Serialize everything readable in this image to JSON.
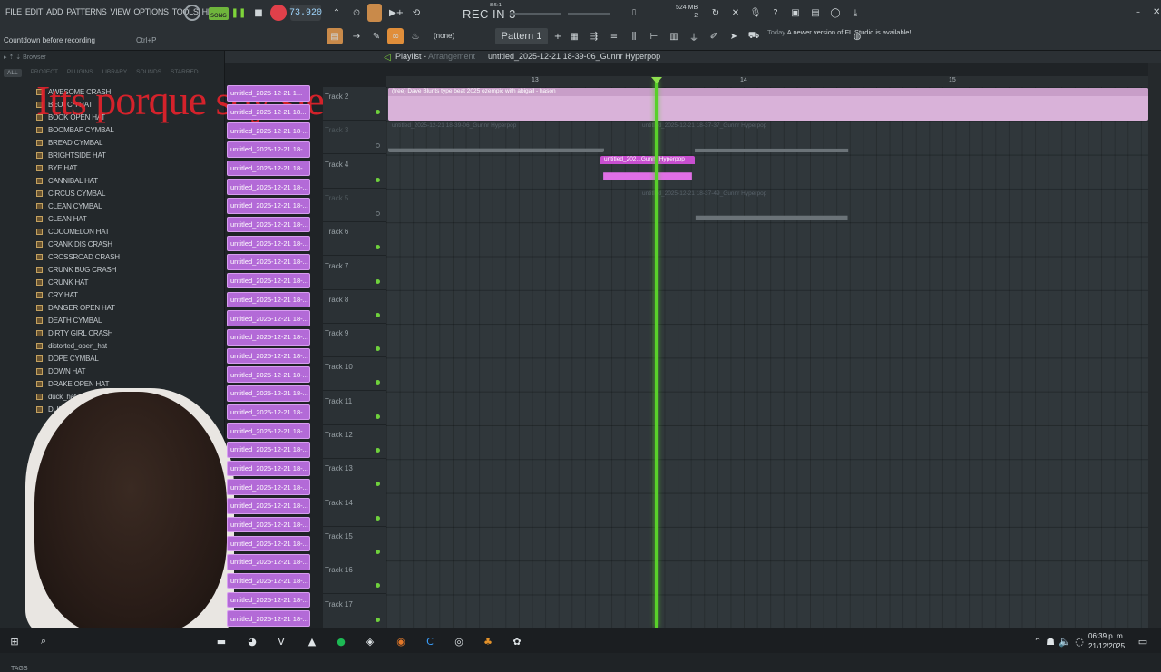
{
  "menu": [
    "FILE",
    "EDIT",
    "ADD",
    "PATTERNS",
    "VIEW",
    "OPTIONS",
    "TOOLS",
    "HELP"
  ],
  "hint": {
    "text": "Countdown before recording",
    "key": "Ctrl+P"
  },
  "transport": {
    "mode": "SONG",
    "tempo": "73.920",
    "rec": "REC IN 3",
    "time_top": "8:5:1",
    "mem": "524 MB",
    "mem2": "2"
  },
  "toolbar2": {
    "none": "(none)",
    "pattern": "Pattern 1",
    "news_day": "Today",
    "news_text": "A newer version of FL Studio is available!"
  },
  "browser": {
    "title": "Browser",
    "tabs": [
      "ALL",
      "PROJECT",
      "PLUGINS",
      "LIBRARY",
      "SOUNDS",
      "STARRED"
    ],
    "items": [
      "AWESOME CRASH",
      "BEOTCH HAT",
      "BOOK OPEN HAT",
      "BOOMBAP CYMBAL",
      "BREAD CYMBAL",
      "BRIGHTSIDE HAT",
      "BYE HAT",
      "CANNIBAL HAT",
      "CIRCUS CYMBAL",
      "CLEAN CYMBAL",
      "CLEAN HAT",
      "COCOMELON HAT",
      "CRANK DIS CRASH",
      "CROSSROAD CRASH",
      "CRUNK BUG CRASH",
      "CRUNK HAT",
      "CRY HAT",
      "DANGER OPEN HAT",
      "DEATH CYMBAL",
      "DIRTY GIRL CRASH",
      "distorted_open_hat",
      "DOPE CYMBAL",
      "DOWN HAT",
      "DRAKE OPEN HAT",
      "duck_hat",
      "DUS"
    ],
    "tags": "TAGS",
    "overlay": "Itts porque soy siego"
  },
  "clips": [
    "untitled_2025-12-21 1...",
    "untitled_2025-12-21 18...",
    "untitled_2025-12-21 18-...",
    "untitled_2025-12-21 18-...",
    "untitled_2025-12-21 18-...",
    "untitled_2025-12-21 18-...",
    "untitled_2025-12-21 18-...",
    "untitled_2025-12-21 18-...",
    "untitled_2025-12-21 18-...",
    "untitled_2025-12-21 18-...",
    "untitled_2025-12-21 18-...",
    "untitled_2025-12-21 18-...",
    "untitled_2025-12-21 18-...",
    "untitled_2025-12-21 18-...",
    "untitled_2025-12-21 18-...",
    "untitled_2025-12-21 18-...",
    "untitled_2025-12-21 18-...",
    "untitled_2025-12-21 18-...",
    "untitled_2025-12-21 18-...",
    "untitled_2025-12-21 18-...",
    "untitled_2025-12-21 18-...",
    "untitled_2025-12-21 18-...",
    "untitled_2025-12-21 18-...",
    "untitled_2025-12-21 18-...",
    "untitled_2025-12-21 18-...",
    "untitled_2025-12-21 18-...",
    "untitled_2025-12-21 18-...",
    "untitled_2025-12-21 18-...",
    "untitled_2025-12-21 18-..."
  ],
  "playlist": {
    "title": "Playlist",
    "mode": "Arrangement",
    "file": "untitled_2025-12-21 18-39-06_Gunnr Hyperpop",
    "ruler": [
      "13",
      "14",
      "15"
    ],
    "tracks": [
      "Track 2",
      "Track 3",
      "Track 4",
      "Track 5",
      "Track 6",
      "Track 7",
      "Track 8",
      "Track 9",
      "Track 10",
      "Track 11",
      "Track 12",
      "Track 13",
      "Track 14",
      "Track 15",
      "Track 16",
      "Track 17"
    ],
    "audio_clips": [
      {
        "label": "(free) Dave Blunts type beat 2025 ozempic with abigail - hason"
      },
      {
        "label": "untitled_2025-12-21 18-39-06_Gunnr Hyperpop"
      },
      {
        "label": "untitled_2025-12-21 18-37-37_Gunnr Hyperpop"
      },
      {
        "label": "untitled_202...Gunnr Hyperpop"
      },
      {
        "label": "untitled_2025-12-21 18-37-49_Gunnr Hyperpop"
      }
    ]
  },
  "clock": {
    "time": "06:39 p. m.",
    "date": "21/12/2025"
  }
}
